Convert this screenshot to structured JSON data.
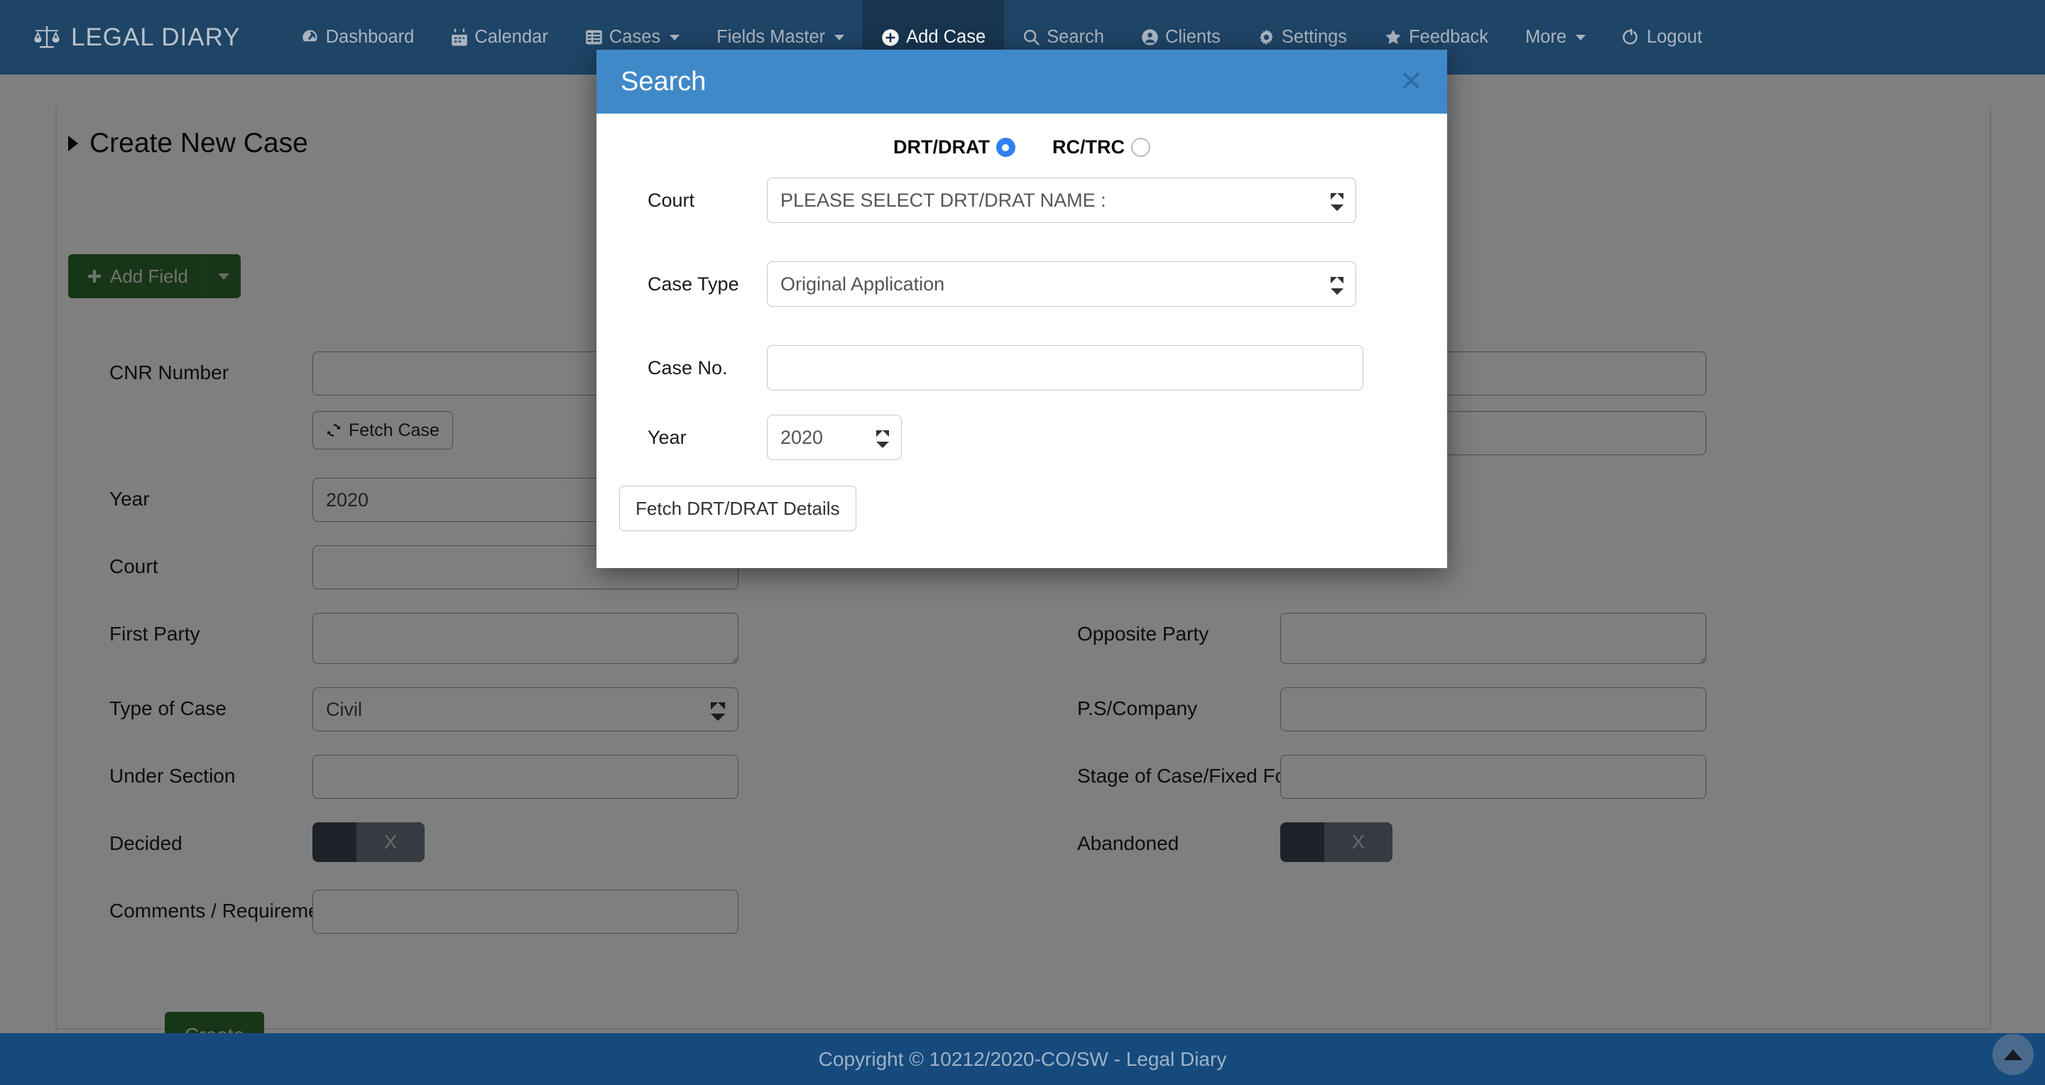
{
  "navbar": {
    "brand": "LEGAL DIARY",
    "brand_icon": "scales-of-justice-icon",
    "items": [
      {
        "label": "Dashboard",
        "icon": "dashboard-icon",
        "caret": false,
        "active": false
      },
      {
        "label": "Calendar",
        "icon": "calendar-icon",
        "caret": false,
        "active": false
      },
      {
        "label": "Cases",
        "icon": "list-icon",
        "caret": true,
        "active": false
      },
      {
        "label": "Fields Master",
        "icon": "",
        "caret": true,
        "active": false
      },
      {
        "label": "Add Case",
        "icon": "plus-circle-icon",
        "caret": false,
        "active": true
      },
      {
        "label": "Search",
        "icon": "search-icon",
        "caret": false,
        "active": false
      },
      {
        "label": "Clients",
        "icon": "user-circle-icon",
        "caret": false,
        "active": false
      },
      {
        "label": "Settings",
        "icon": "gear-icon",
        "caret": false,
        "active": false
      },
      {
        "label": "Feedback",
        "icon": "star-icon",
        "caret": false,
        "active": false
      },
      {
        "label": "More",
        "icon": "",
        "caret": true,
        "active": false
      },
      {
        "label": "Logout",
        "icon": "logout-icon",
        "caret": false,
        "active": false
      }
    ]
  },
  "page": {
    "title": "Create New Case",
    "add_field_label": "Add Field",
    "add_field_icon": "plus-icon",
    "create_label": "Create",
    "fetch_case_label": "Fetch Case",
    "fetch_case_icon": "refresh-icon"
  },
  "form": {
    "left": [
      {
        "label": "CNR Number",
        "type": "text",
        "value": ""
      },
      {
        "label": "Year",
        "type": "text",
        "value": "2020"
      },
      {
        "label": "Court",
        "type": "text",
        "value": ""
      },
      {
        "label": "First Party",
        "type": "textarea",
        "value": ""
      },
      {
        "label": "Type of Case",
        "type": "select",
        "value": "Civil"
      },
      {
        "label": "Under Section",
        "type": "text",
        "value": ""
      },
      {
        "label": "Decided",
        "type": "toggle",
        "value": "X"
      },
      {
        "label": "Comments / Requirements",
        "type": "text",
        "value": ""
      }
    ],
    "right": [
      {
        "label": "Opposite Party",
        "type": "textarea",
        "value": ""
      },
      {
        "label": "P.S/Company",
        "type": "text",
        "value": ""
      },
      {
        "label": "Stage of Case/Fixed For",
        "type": "text",
        "value": ""
      },
      {
        "label": "Abandoned",
        "type": "toggle",
        "value": "X"
      }
    ]
  },
  "modal": {
    "title": "Search",
    "close_icon": "close-icon",
    "radios": [
      {
        "label": "DRT/DRAT",
        "checked": true
      },
      {
        "label": "RC/TRC",
        "checked": false
      }
    ],
    "fields": {
      "court_label": "Court",
      "court_value": "PLEASE SELECT DRT/DRAT NAME :",
      "case_type_label": "Case Type",
      "case_type_value": "Original Application",
      "case_no_label": "Case No.",
      "case_no_value": "",
      "case_no_placeholder": "",
      "year_label": "Year",
      "year_value": "2020"
    },
    "submit_label": "Fetch DRT/DRAT Details"
  },
  "footer": {
    "copyright": "Copyright © 10212/2020-CO/SW - Legal Diary",
    "scroll_top_icon": "chevron-up-icon"
  },
  "colors": {
    "navbar_bg": "#1e4466",
    "navbar_active_bg": "#17354f",
    "modal_header_bg": "#4089c8",
    "footer_bg": "#164a7d",
    "green_button": "#2f6b2f",
    "radio_accent": "#2f80f0"
  }
}
